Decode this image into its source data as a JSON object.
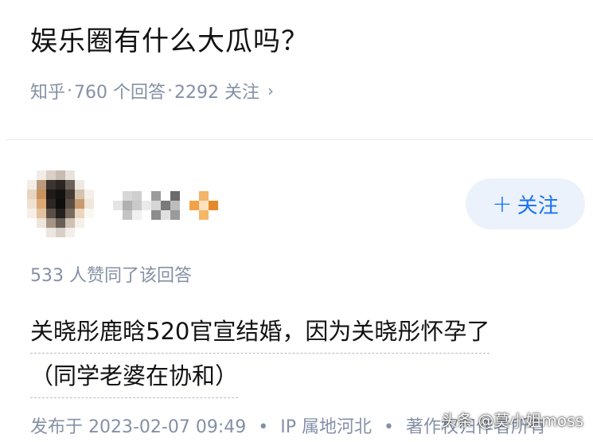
{
  "question": {
    "title": "娱乐圈有什么大瓜吗？",
    "source": "知乎",
    "answers_count": "760 个回答",
    "follow_count": "2292 关注"
  },
  "author": {
    "avatar": "pixelated-avatar",
    "name_hidden": true,
    "follow_label": "关注"
  },
  "answer": {
    "likes": "533 人赞同了该回答",
    "line1": "关晓彤鹿晗520官宣结婚，因为关晓彤怀孕了",
    "line2": "（同学老婆在协和）",
    "published": "发布于 2023-02-07 09:49",
    "ip": "IP 属地河北",
    "copyright": "著作权归作者所有"
  },
  "watermark": "头条 @莫小姐moss",
  "colors": {
    "meta_gray": "#8590a6",
    "accent_blue": "#1772f6",
    "button_bg": "#ebf2fb",
    "text": "#121212"
  }
}
